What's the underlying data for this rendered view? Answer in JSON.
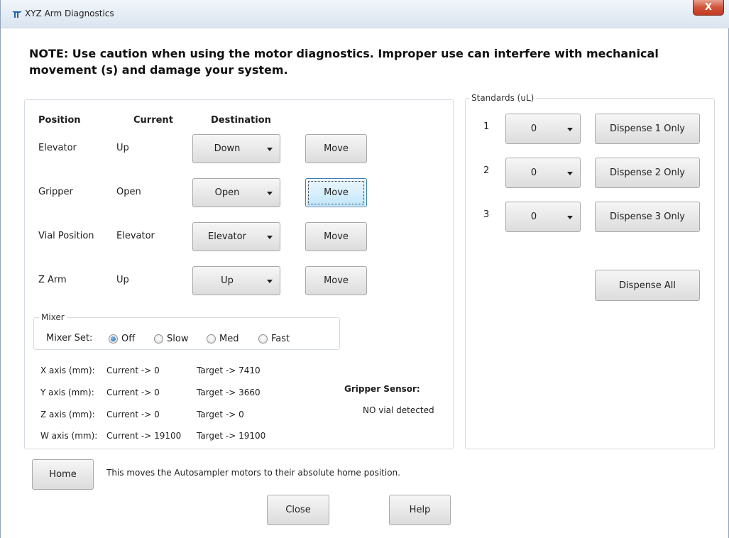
{
  "window": {
    "title": "XYZ Arm Diagnostics",
    "close_glyph": "X"
  },
  "note": "NOTE: Use caution when using the motor diagnostics. Improper use can interfere with mechanical movement (s) and damage your system.",
  "positions": {
    "headers": {
      "position": "Position",
      "current": "Current",
      "destination": "Destination"
    },
    "rows": [
      {
        "name": "Elevator",
        "current": "Up",
        "destination": "Down",
        "move_label": "Move"
      },
      {
        "name": "Gripper",
        "current": "Open",
        "destination": "Open",
        "move_label": "Move"
      },
      {
        "name": "Vial Position",
        "current": "Elevator",
        "destination": "Elevator",
        "move_label": "Move"
      },
      {
        "name": "Z Arm",
        "current": "Up",
        "destination": "Up",
        "move_label": "Move"
      }
    ]
  },
  "mixer": {
    "legend": "Mixer",
    "label": "Mixer Set:",
    "options": [
      "Off",
      "Slow",
      "Med",
      "Fast"
    ],
    "selected": "Off"
  },
  "axes": [
    {
      "label": "X axis (mm):",
      "current": "Current -> 0",
      "target": "Target -> 7410"
    },
    {
      "label": "Y axis (mm):",
      "current": "Current -> 0",
      "target": "Target -> 3660"
    },
    {
      "label": "Z axis (mm):",
      "current": "Current -> 0",
      "target": "Target -> 0"
    },
    {
      "label": "W axis (mm):",
      "current": "Current -> 19100",
      "target": "Target -> 19100"
    }
  ],
  "gripper_sensor": {
    "label": "Gripper Sensor:",
    "status": "NO vial detected"
  },
  "standards": {
    "legend": "Standards (uL)",
    "rows": [
      {
        "index": "1",
        "value": "0",
        "button": "Dispense 1 Only"
      },
      {
        "index": "2",
        "value": "0",
        "button": "Dispense 2 Only"
      },
      {
        "index": "3",
        "value": "0",
        "button": "Dispense 3 Only"
      }
    ],
    "dispense_all": "Dispense All"
  },
  "home": {
    "button": "Home",
    "description": "This moves the Autosampler motors to their absolute home position."
  },
  "footer": {
    "close": "Close",
    "help": "Help"
  }
}
